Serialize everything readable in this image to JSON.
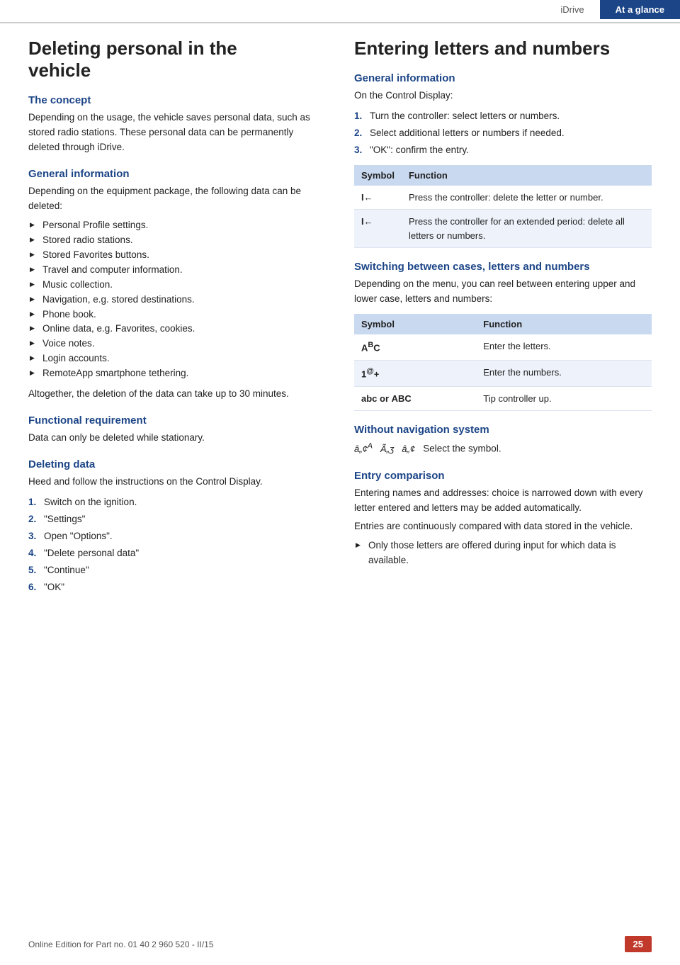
{
  "header": {
    "idrive_label": "iDrive",
    "tab_label": "At a glance"
  },
  "left": {
    "page_title_line1": "Deleting personal in the",
    "page_title_line2": "vehicle",
    "concept_heading": "The concept",
    "concept_text": "Depending on the usage, the vehicle saves personal data, such as stored radio stations. These personal data can be permanently deleted through iDrive.",
    "general_info_heading": "General information",
    "general_info_text": "Depending on the equipment package, the following data can be deleted:",
    "bullet_items": [
      "Personal Profile settings.",
      "Stored radio stations.",
      "Stored Favorites buttons.",
      "Travel and computer information.",
      "Music collection.",
      "Navigation, e.g. stored destinations.",
      "Phone book.",
      "Online data, e.g. Favorites, cookies.",
      "Voice notes.",
      "Login accounts.",
      "RemoteApp smartphone tethering."
    ],
    "bulk_text": "Altogether, the deletion of the data can take up to 30 minutes.",
    "functional_req_heading": "Functional requirement",
    "functional_req_text": "Data can only be deleted while stationary.",
    "deleting_data_heading": "Deleting data",
    "deleting_data_text": "Heed and follow the instructions on the Control Display.",
    "steps": [
      {
        "num": "1.",
        "text": "Switch on the ignition."
      },
      {
        "num": "2.",
        "text": "\"Settings\""
      },
      {
        "num": "3.",
        "text": "Open \"Options\"."
      },
      {
        "num": "4.",
        "text": "\"Delete personal data\""
      },
      {
        "num": "5.",
        "text": "\"Continue\""
      },
      {
        "num": "6.",
        "text": "\"OK\""
      }
    ]
  },
  "right": {
    "page_title": "Entering letters and numbers",
    "general_info_heading": "General information",
    "general_info_intro": "On the Control Display:",
    "steps": [
      {
        "num": "1.",
        "text": "Turn the controller: select letters or numbers."
      },
      {
        "num": "2.",
        "text": "Select additional letters or numbers if needed."
      },
      {
        "num": "3.",
        "text": "\"OK\": confirm the entry."
      }
    ],
    "table1": {
      "headers": [
        "Symbol",
        "Function"
      ],
      "rows": [
        {
          "symbol": "I←",
          "function": "Press the controller: delete the letter or number."
        },
        {
          "symbol": "I←",
          "function": "Press the controller for an extended period: delete all letters or numbers."
        }
      ]
    },
    "switching_heading": "Switching between cases, letters and numbers",
    "switching_text": "Depending on the menu, you can reel between entering upper and lower case, letters and numbers:",
    "table2": {
      "headers": [
        "Symbol",
        "Function"
      ],
      "rows": [
        {
          "symbol": "AᴪC",
          "function": "Enter the letters."
        },
        {
          "symbol": "1@+",
          "function": "Enter the numbers."
        },
        {
          "symbol": "abc or ABC",
          "function": "Tip controller up."
        }
      ]
    },
    "without_nav_heading": "Without navigation system",
    "without_nav_text": "Select the symbol.",
    "without_nav_symbols": "â„¢ᴮ  Ã„ʒ  â„¢",
    "entry_comparison_heading": "Entry comparison",
    "entry_comparison_text1": "Entering names and addresses: choice is narrowed down with every letter entered and letters may be added automatically.",
    "entry_comparison_text2": "Entries are continuously compared with data stored in the vehicle.",
    "entry_comparison_bullet": "Only those letters are offered during input for which data is available."
  },
  "footer": {
    "copyright_text": "Online Edition for Part no. 01 40 2 960 520 - II/15",
    "page_number": "25"
  }
}
